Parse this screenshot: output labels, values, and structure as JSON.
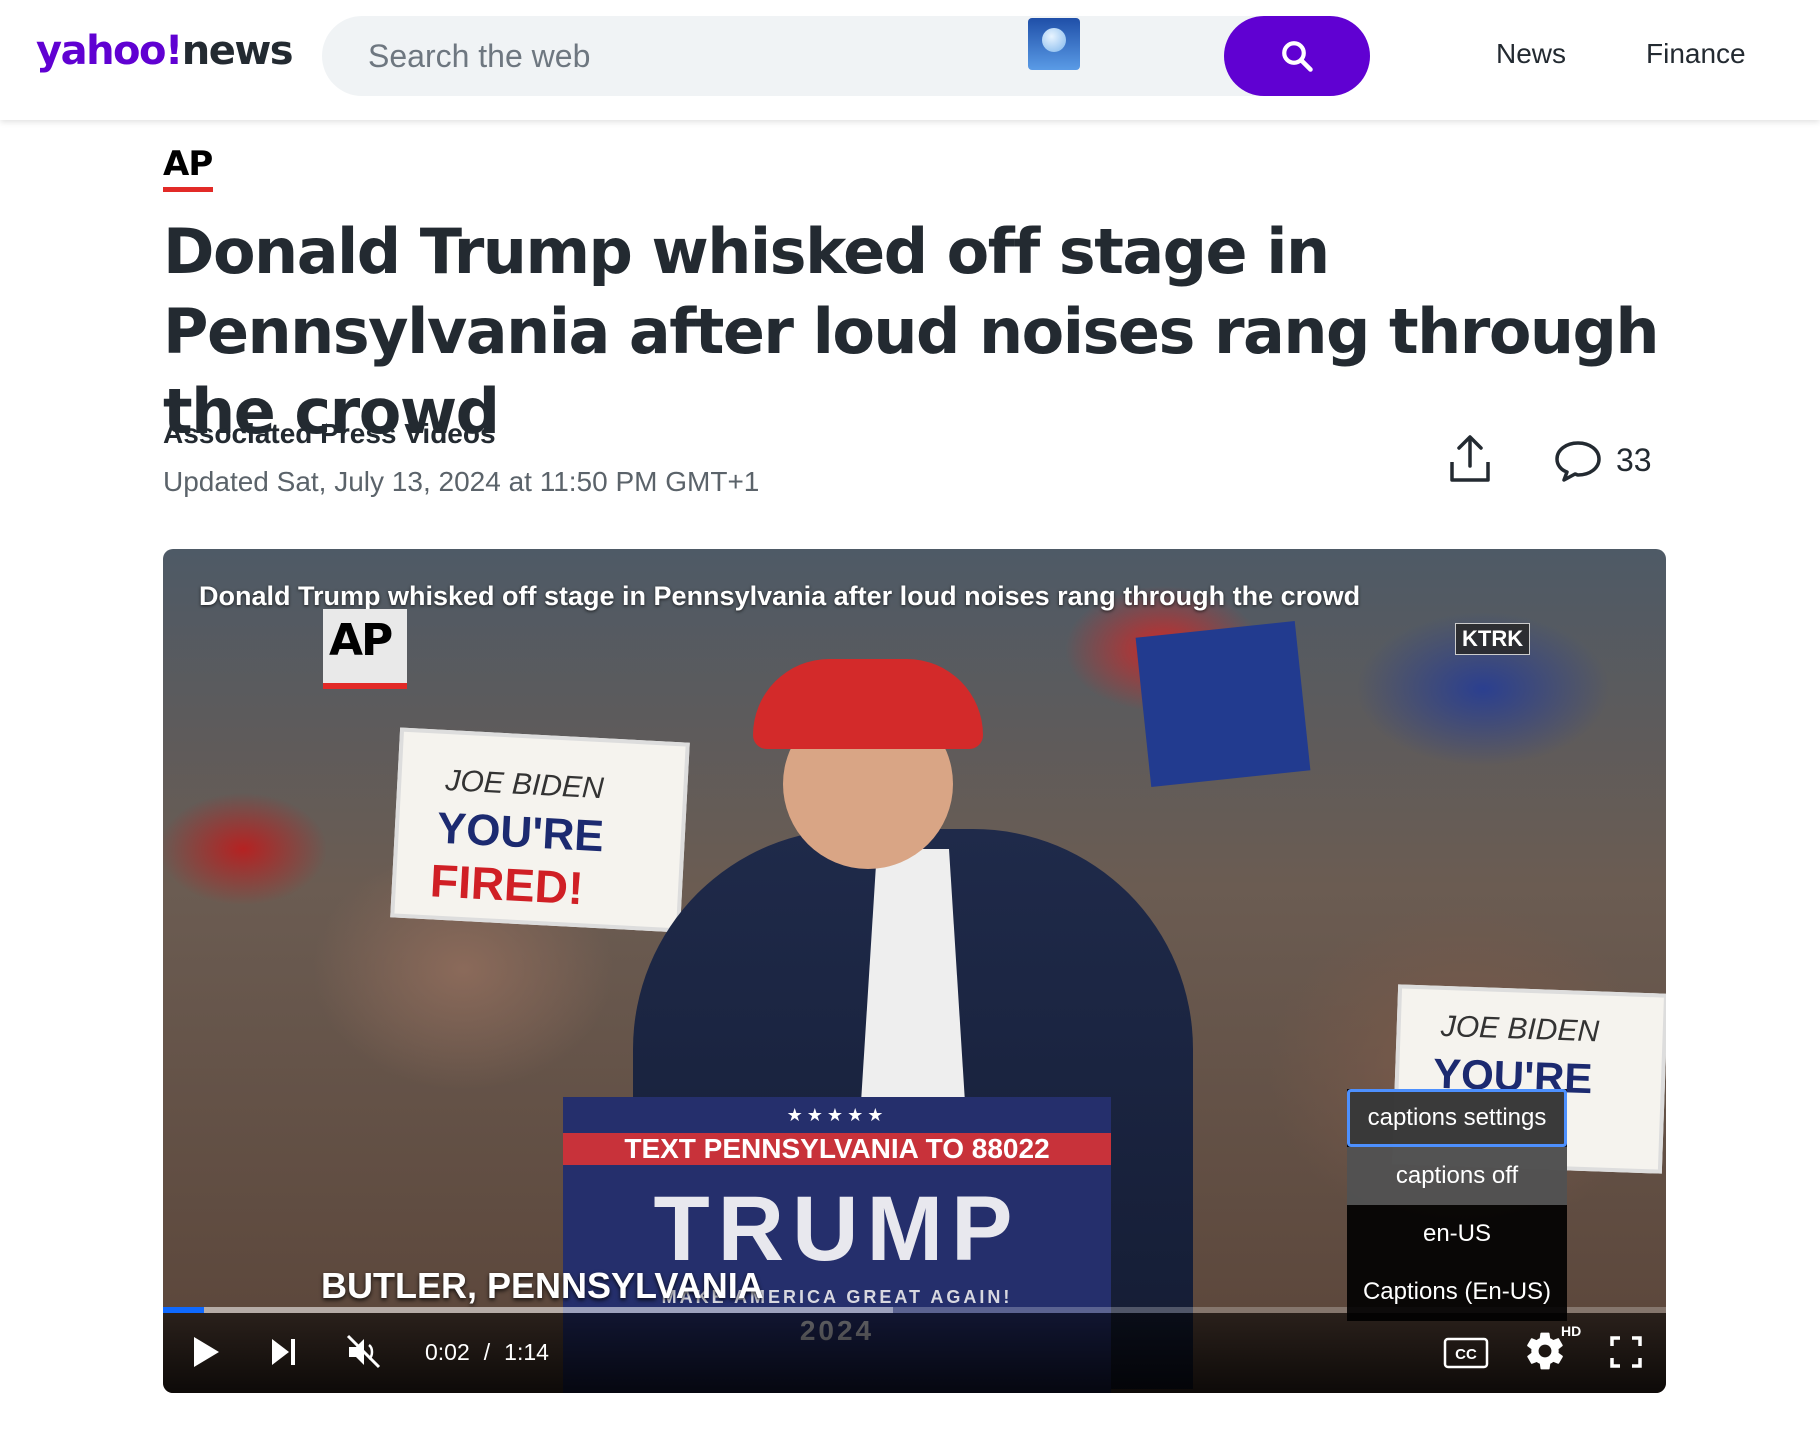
{
  "header": {
    "logo_brand": "yahoo!",
    "logo_section": "news",
    "search_placeholder": "Search the web",
    "nav": [
      {
        "label": "News"
      },
      {
        "label": "Finance"
      }
    ]
  },
  "article": {
    "source": "AP",
    "headline": "Donald Trump whisked off stage in Pennsylvania after loud noises rang through the crowd",
    "byline": "Associated Press Videos",
    "updated": "Updated Sat, July 13, 2024 at 11:50 PM GMT+1",
    "comment_count": "33"
  },
  "video": {
    "title_overlay": "Donald Trump whisked off stage in Pennsylvania after loud noises rang through the crowd",
    "watermark": "AP",
    "station_bug": "KTRK",
    "sign_line1": "JOE BIDEN",
    "sign_line2": "YOU'RE",
    "sign_line3": "FIRED!",
    "sign_right_line1": "JOE BIDEN",
    "sign_right_line2": "YOU'RE",
    "podium_stars": "★★★★★",
    "podium_text": "TEXT PENNSYLVANIA TO 88022",
    "podium_name": "TRUMP",
    "podium_slogan": "MAKE AMERICA GREAT AGAIN!",
    "podium_year": "2024",
    "location": "BUTLER, PENNSYLVANIA",
    "current_time": "0:02",
    "time_separator": "/",
    "duration": "1:14",
    "progress_fraction": 0.027,
    "hd_badge": "HD",
    "cc_label": "CC",
    "captions_menu": [
      {
        "label": "captions settings"
      },
      {
        "label": "captions off"
      },
      {
        "label": "en-US"
      },
      {
        "label": "Captions (En-US)"
      }
    ]
  },
  "colors": {
    "brand_purple": "#6001d2",
    "ap_red": "#e22a27",
    "progress_blue": "#0f69ff"
  },
  "icons": [
    "search-icon",
    "share-icon",
    "comment-icon",
    "play-icon",
    "skip-next-icon",
    "mute-icon",
    "closed-captions-icon",
    "gear-icon",
    "fullscreen-icon"
  ]
}
